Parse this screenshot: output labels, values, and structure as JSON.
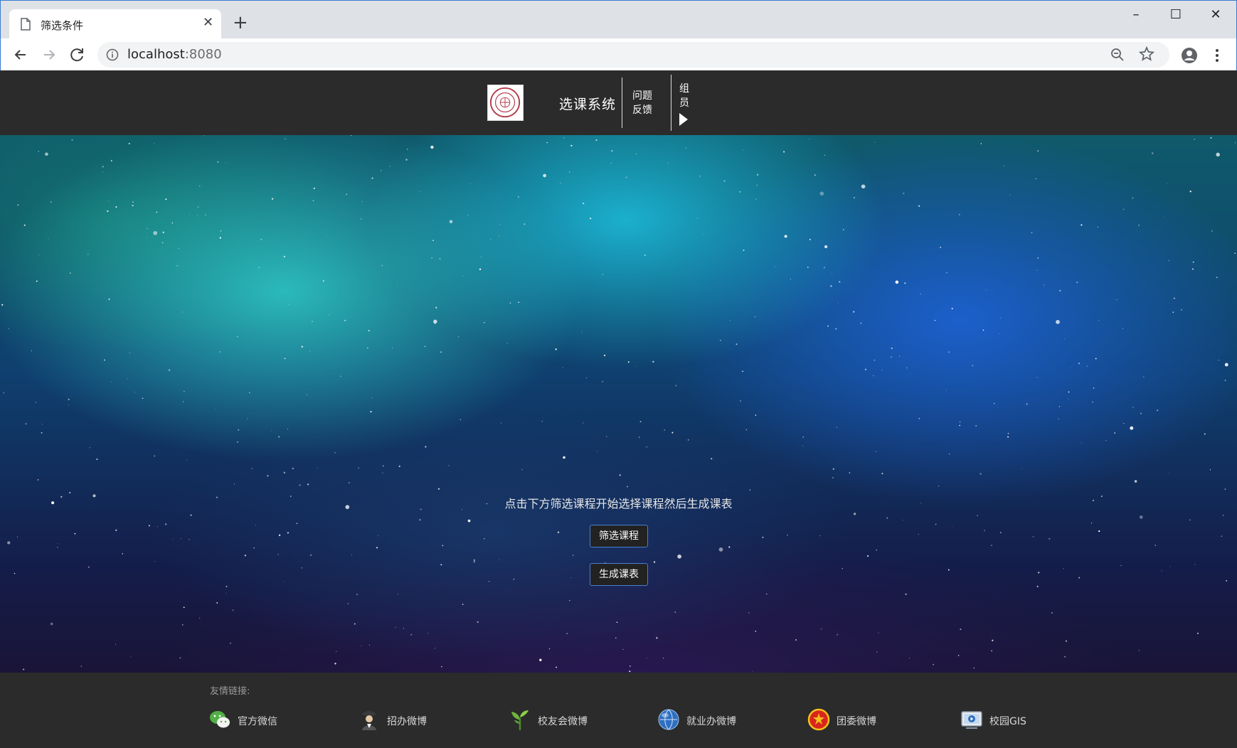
{
  "browser": {
    "tab_title": "筛选条件",
    "url_host": "localhost",
    "url_port": ":8080"
  },
  "header": {
    "site_title": "选课系统",
    "feedback_label": "问题反馈",
    "members_label": "组员"
  },
  "hero": {
    "instruction": "点击下方筛选课程开始选择课程然后生成课表",
    "filter_button": "筛选课程",
    "generate_button": "生成课表"
  },
  "footer": {
    "label": "友情链接:",
    "links": [
      {
        "label": "官方微信",
        "icon": "wechat-icon"
      },
      {
        "label": "招办微博",
        "icon": "graduate-icon"
      },
      {
        "label": "校友会微博",
        "icon": "sprout-icon"
      },
      {
        "label": "就业办微博",
        "icon": "globe-icon"
      },
      {
        "label": "团委微博",
        "icon": "league-badge-icon"
      },
      {
        "label": "校园GIS",
        "icon": "video-screen-icon"
      }
    ]
  },
  "colors": {
    "header_bg": "#2b2b2b",
    "button_border": "#4a7fd0",
    "chrome_bg": "#dee1e6"
  }
}
